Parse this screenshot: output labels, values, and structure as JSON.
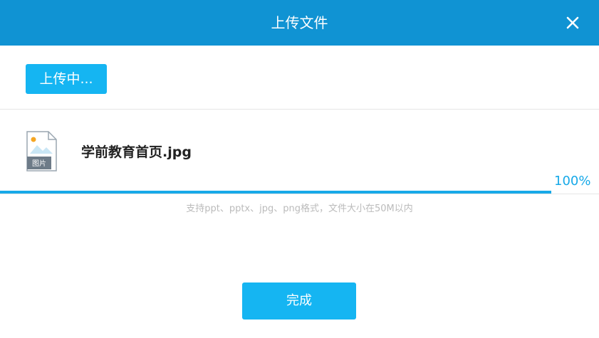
{
  "dialog": {
    "title": "上传文件",
    "close_icon": "close-icon"
  },
  "toolbar": {
    "upload_label": "上传中..."
  },
  "file": {
    "name": "学前教育首页.jpg",
    "icon": "image-file-icon",
    "icon_label": "图片",
    "progress_percent": 100,
    "progress_text": "100%"
  },
  "hint": "支持ppt、pptx、jpg、png格式，文件大小在50M以内",
  "footer": {
    "done_label": "完成"
  },
  "colors": {
    "header": "#1093d3",
    "button": "#15b5f2",
    "progress": "#17a9e8",
    "hint_text": "#bbbbbb"
  }
}
